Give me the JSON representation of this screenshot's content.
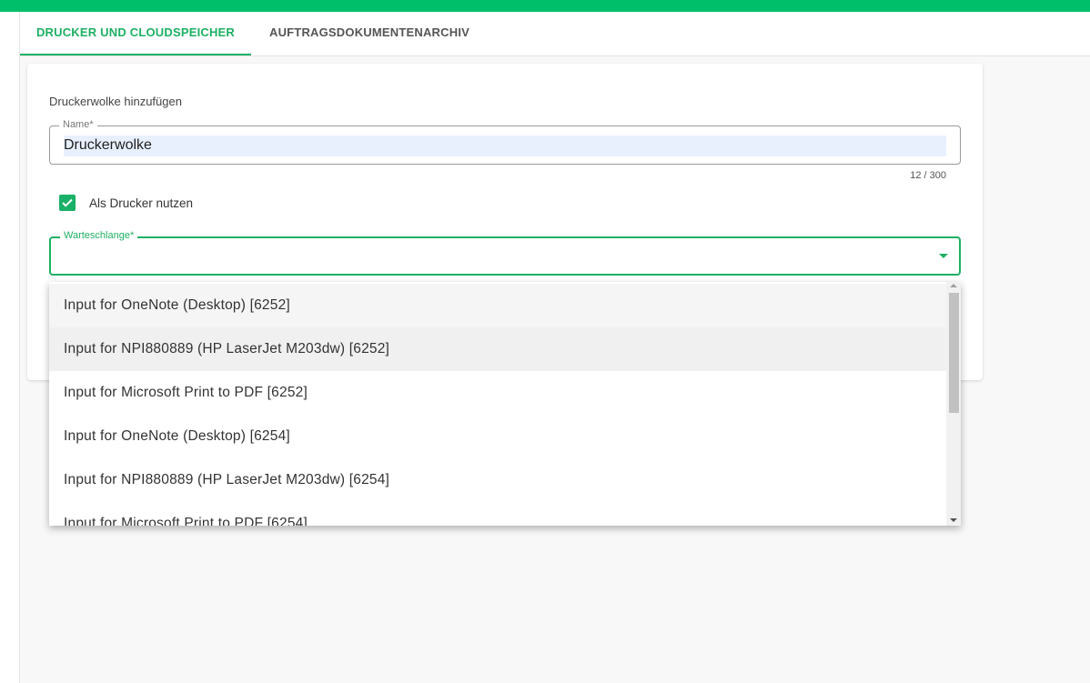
{
  "tabs": [
    {
      "label": "DRUCKER UND CLOUDSPEICHER",
      "active": true
    },
    {
      "label": "AUFTRAGSDOKUMENTENARCHIV",
      "active": false
    }
  ],
  "form": {
    "section_title": "Druckerwolke hinzufügen",
    "name_label": "Name*",
    "name_value": "Druckerwolke",
    "name_counter": "12 / 300",
    "use_as_printer_label": "Als Drucker nutzen",
    "use_as_printer_checked": true,
    "queue_label": "Warteschlange*",
    "queue_value": ""
  },
  "dropdown": {
    "options": [
      "Input for OneNote (Desktop) [6252]",
      "Input for NPI880889 (HP LaserJet M203dw) [6252]",
      "Input for Microsoft Print to PDF [6252]",
      "Input for OneNote (Desktop) [6254]",
      "Input for NPI880889 (HP LaserJet M203dw) [6254]",
      "Input for Microsoft Print to PDF [6254]"
    ]
  },
  "colors": {
    "accent": "#1db063",
    "topbar": "#00bf6a"
  }
}
